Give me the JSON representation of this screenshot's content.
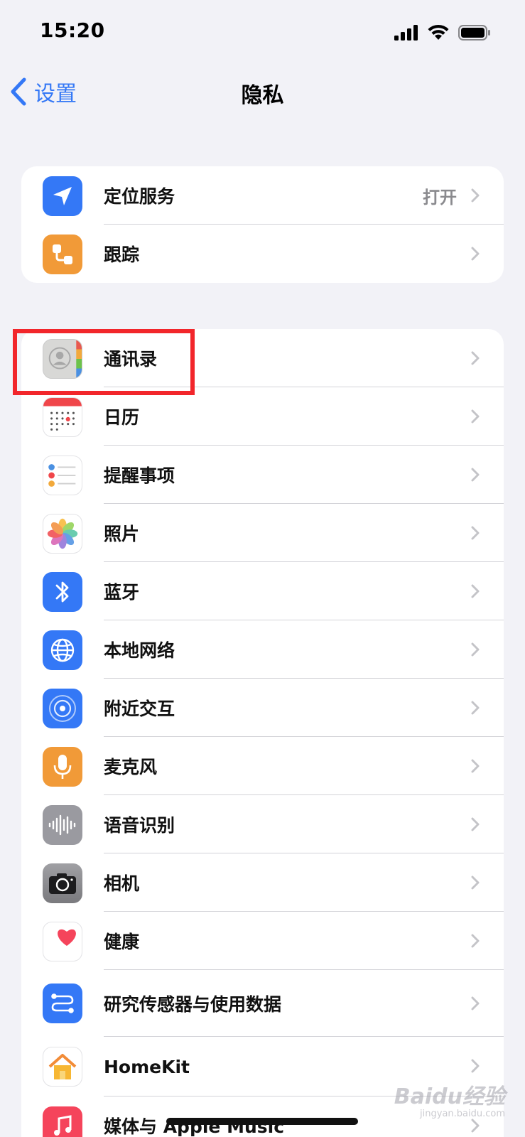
{
  "status_bar": {
    "time": "15:20"
  },
  "nav": {
    "back_label": "设置",
    "title": "隐私"
  },
  "groups": [
    {
      "items": [
        {
          "label": "定位服务",
          "value": "打开",
          "icon": "location-arrow-icon",
          "color": "#3478f6"
        },
        {
          "label": "跟踪",
          "icon": "tracking-icon",
          "color": "#f19a38"
        }
      ]
    },
    {
      "items": [
        {
          "label": "通讯录",
          "icon": "contacts-icon",
          "color": "#d2d2d2"
        },
        {
          "label": "日历",
          "icon": "calendar-icon",
          "color": "#ffffff"
        },
        {
          "label": "提醒事项",
          "icon": "reminders-icon",
          "color": "#ffffff"
        },
        {
          "label": "照片",
          "icon": "photos-icon",
          "color": "#ffffff"
        },
        {
          "label": "蓝牙",
          "icon": "bluetooth-icon",
          "color": "#3478f6"
        },
        {
          "label": "本地网络",
          "icon": "globe-icon",
          "color": "#3478f6"
        },
        {
          "label": "附近交互",
          "icon": "nearby-interaction-icon",
          "color": "#3478f6"
        },
        {
          "label": "麦克风",
          "icon": "microphone-icon",
          "color": "#f19a38"
        },
        {
          "label": "语音识别",
          "icon": "speech-waveform-icon",
          "color": "#9a9aa0"
        },
        {
          "label": "相机",
          "icon": "camera-icon",
          "color": "#8a8a8e"
        },
        {
          "label": "健康",
          "icon": "heart-icon",
          "color": "#ffffff"
        },
        {
          "label": "研究传感器与使用数据",
          "icon": "research-sensor-icon",
          "color": "#3478f6"
        },
        {
          "label": "HomeKit",
          "icon": "home-icon",
          "color": "#ffffff"
        },
        {
          "label": "媒体与 Apple Music",
          "icon": "music-icon",
          "color": "#f5445b"
        }
      ]
    }
  ],
  "watermark": {
    "main": "Baidu经验",
    "sub": "jingyan.baidu.com"
  },
  "colors": {
    "accent": "#3478f6",
    "highlight": "#f2262b",
    "background": "#f2f2f7"
  }
}
